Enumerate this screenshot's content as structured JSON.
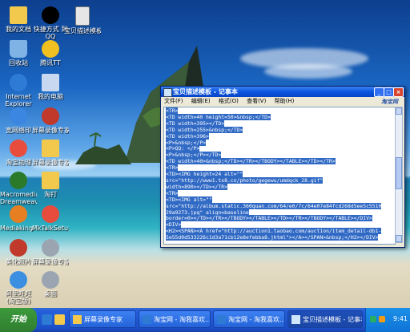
{
  "desktop_icons": [
    {
      "label_line1": "我的文档",
      "label_line2": "",
      "icon": "folder-documents-icon",
      "color": "#f2c94c"
    },
    {
      "label_line1": "快捷方式 到",
      "label_line2": "QQ",
      "icon": "qq-penguin-icon",
      "color": "#000000"
    },
    {
      "label_line1": "宝贝描述模板",
      "label_line2": "",
      "icon": "text-document-icon",
      "color": "#e6e6e6"
    },
    {
      "label_line1": "回收站",
      "label_line2": "",
      "icon": "recycle-bin-icon",
      "color": "#7fb3e6"
    },
    {
      "label_line1": "腾讯TT",
      "label_line2": "",
      "icon": "tencent-tt-icon",
      "color": "#f0c020"
    },
    {
      "label_line1": "Internet",
      "label_line2": "Explorer",
      "icon": "internet-explorer-icon",
      "color": "#2e7bd6"
    },
    {
      "label_line1": "我的电脑",
      "label_line2": "",
      "icon": "my-computer-icon",
      "color": "#c8d8f0"
    },
    {
      "label_line1": "宽网络印",
      "label_line2": "",
      "icon": "network-icon",
      "color": "#3b86e0"
    },
    {
      "label_line1": "屏幕录像专家",
      "label_line2": "",
      "icon": "screen-recorder-icon",
      "color": "#c0392b"
    },
    {
      "label_line1": "淘宝助理",
      "label_line2": "",
      "icon": "taobao-assistant-icon",
      "color": "#e74c3c"
    },
    {
      "label_line1": "屏幕录像专家",
      "label_line2": "",
      "icon": "folder-icon",
      "color": "#f2c94c"
    },
    {
      "label_line1": "Macromedia",
      "label_line2": "Dreamweave...",
      "icon": "dreamweaver-icon",
      "color": "#2a7a2a"
    },
    {
      "label_line1": "淘打",
      "label_line2": "",
      "icon": "folder-icon",
      "color": "#f2c94c"
    },
    {
      "label_line1": "Mediaking Talk",
      "label_line2": "",
      "icon": "mediaking-icon",
      "color": "#e67e22"
    },
    {
      "label_line1": "MkTalkSetup...",
      "label_line2": "",
      "icon": "setup-icon",
      "color": "#e74c3c"
    },
    {
      "label_line1": "美化照片",
      "label_line2": "",
      "icon": "photo-editor-icon",
      "color": "#c0392b"
    },
    {
      "label_line1": "屏幕录像专家V2",
      "label_line2": "",
      "icon": "video-file-icon",
      "color": "#9aa5b1"
    },
    {
      "label_line1": "阿里旺旺",
      "label_line2": "(淘宝版)",
      "icon": "aliwangwang-icon",
      "color": "#3b8fe0"
    },
    {
      "label_line1": "桌面",
      "label_line2": "",
      "icon": "desktop-icon",
      "color": "#9aa5b1"
    }
  ],
  "notepad": {
    "title": "宝贝描述模板 - 记事本",
    "menu": [
      "文件(F)",
      "编辑(E)",
      "格式(O)",
      "查看(V)",
      "帮助(H)"
    ],
    "brand": "淘宝网",
    "lines": [
      "<TR>",
      "<TD width=40 height=50>&nbsp;</TD>",
      "<TD width=395></TD>",
      "<TD width=255>&nbsp;</TD>",
      "<TD width=396>",
      "<P>&nbsp;</P>",
      "<P>QQ: </P>",
      "<P>&nbsp;</P></TD>",
      "<TD width=40>&nbsp;</TD></TR></TBODY></TABLE></TD></TR>",
      "<TR>",
      "<TD><IMG height=24 alt=\"\"",
      "src=\"http://www1.tx8.cn/photo/gegewu/umdqck_28.gif\"",
      "width=890></TD></TR>",
      "<TR>",
      "<TD><IMG alt=\"\"",
      "src=\"http://album.static.360quan.com/64/e0/7c/64e07e84fcd268d5ee5c5510",
      "29a9273.jpg\" align=baseline",
      "border=0></TD></TR></TBODY></TABLE></TD></TR></TBODY></TABLE></DIV>",
      "<DIV>",
      "<H2><SPAN><A href=\"http://auction1.taobao.com/auction/item_detail-db1-",
      "5e55d0d533226c1d3a71cb12e8efebba8.jhtml\"></A></SPAN>&nbsp;</H2></DIV>"
    ]
  },
  "taskbar": {
    "start_label": "开始",
    "tasks": [
      {
        "label": "屏幕录像专家",
        "active": false
      },
      {
        "label": "淘宝网 - 淘我喜欢...",
        "active": false
      },
      {
        "label": "淘宝网 - 淘我喜欢...",
        "active": false
      },
      {
        "label": "宝贝描述模板 - 记事本",
        "active": true
      }
    ],
    "clock": "9:41"
  },
  "colors": {
    "selection": "#316ac5",
    "titlebar": "#0a56df",
    "taskbar": "#245edb"
  }
}
